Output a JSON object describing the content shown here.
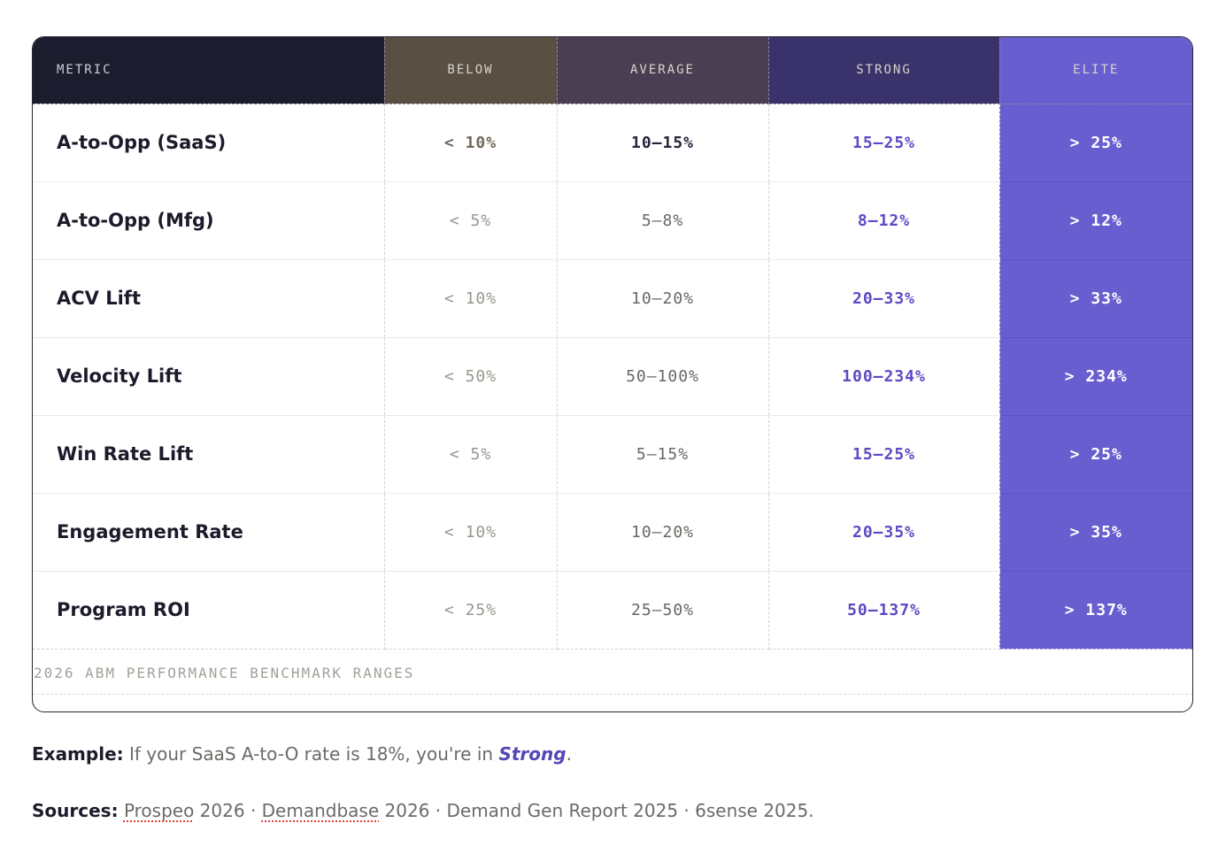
{
  "table": {
    "headers": [
      "METRIC",
      "BELOW",
      "AVERAGE",
      "STRONG",
      "ELITE"
    ],
    "header_colors": [
      "#1b1c2e",
      "#5a4f43",
      "#4a3f52",
      "#3a336b",
      "#695ecf"
    ],
    "strong_text_color": "#5a4bc4",
    "rows": [
      [
        "A-to-Opp (SaaS)",
        "< 10%",
        "10–15%",
        "15–25%",
        "> 25%"
      ],
      [
        "A-to-Opp (Mfg)",
        "< 5%",
        "5–8%",
        "8–12%",
        "> 12%"
      ],
      [
        "ACV Lift",
        "< 10%",
        "10–20%",
        "20–33%",
        "> 33%"
      ],
      [
        "Velocity Lift",
        "< 50%",
        "50–100%",
        "100–234%",
        "> 234%"
      ],
      [
        "Win Rate Lift",
        "< 5%",
        "5–15%",
        "15–25%",
        "> 25%"
      ],
      [
        "Engagement Rate",
        "< 10%",
        "10–20%",
        "20–35%",
        "> 35%"
      ],
      [
        "Program ROI",
        "< 25%",
        "25–50%",
        "50–137%",
        "> 137%"
      ]
    ],
    "caption": "2026 ABM PERFORMANCE BENCHMARK RANGES"
  },
  "example": {
    "label": "Example:",
    "text_before": " If your SaaS A-to-O rate is 18%, you're in ",
    "emphasis": "Strong",
    "text_after": "."
  },
  "sources": {
    "label": "Sources:",
    "items": [
      "Prospeo",
      " 2026 · ",
      "Demandbase",
      " 2026 · Demand Gen Report 2025 · 6sense 2025."
    ]
  }
}
